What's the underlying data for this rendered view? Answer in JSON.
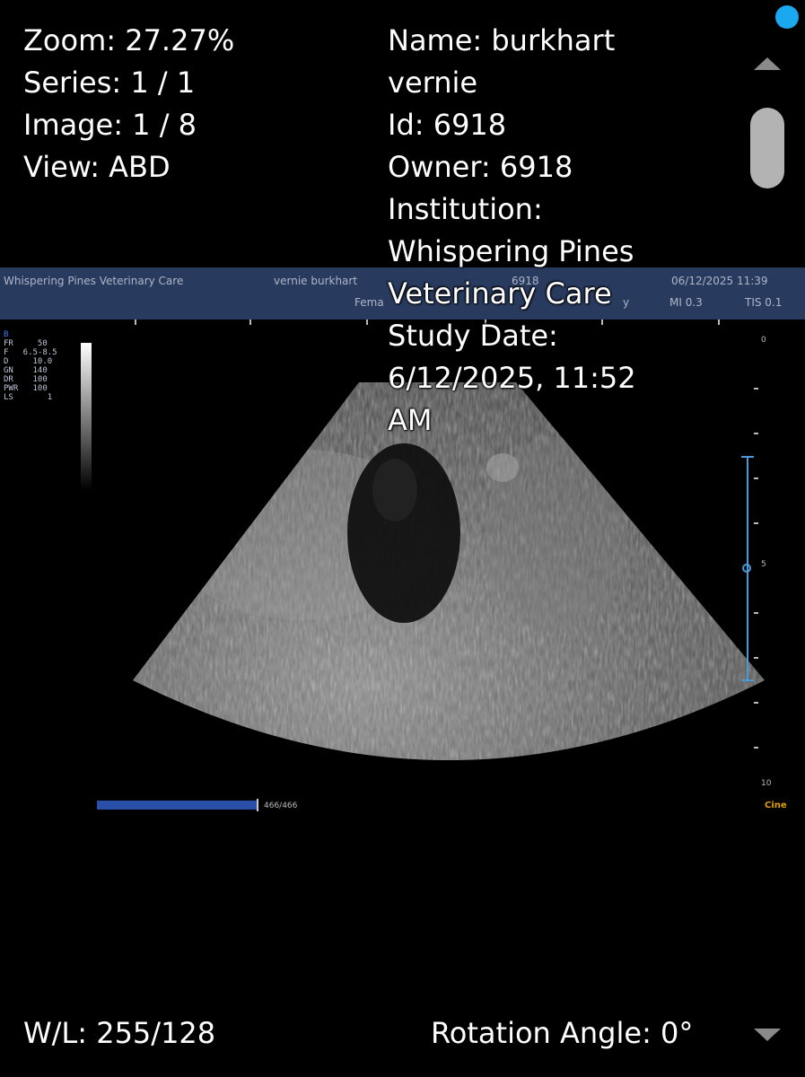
{
  "overlay": {
    "zoom": "Zoom: 27.27%",
    "series": "Series: 1 / 1",
    "image": "Image: 1 / 8",
    "view": "View: ABD",
    "name_line1": "Name: burkhart",
    "name_line2": "vernie",
    "id": "Id: 6918",
    "owner": "Owner: 6918",
    "institution_label": "Institution:",
    "institution_line1": "Whispering Pines",
    "institution_line2": "Veterinary Care",
    "study_date_label": "Study Date:",
    "study_date_line1": "6/12/2025, 11:52",
    "study_date_line2": "AM",
    "wl": "W/L: 255/128",
    "rotation": "Rotation Angle: 0°"
  },
  "ultrasound": {
    "banner_clinic": "Whispering Pines Veterinary Care",
    "banner_patient": "vernie burkhart",
    "banner_sex": "Fema",
    "banner_id": "6918",
    "banner_suffix": "y",
    "banner_datetime": "06/12/2025 11:39",
    "banner_mi": "MI 0.3",
    "banner_tis": "TIS 0.1",
    "mode": "B",
    "params": [
      "FR     50",
      "F   6.5-8.5",
      "D     10.0",
      "GN    140",
      "DR    100",
      "PWR   100",
      "LS       1"
    ],
    "depth_top": "0",
    "depth_mid": "5",
    "depth_bottom": "10",
    "cine_label": "Cine",
    "cine_count": "466/466",
    "cine_progress": 1.0
  },
  "colors": {
    "status_dot": "#1aa8f0",
    "banner": "#283a5e",
    "focus": "#4a9ad8",
    "cine_bar": "#2a4fa8",
    "cine_label": "#e0a000"
  },
  "icons": {
    "status": "status-dot-icon",
    "scroll_up": "chevron-up-icon",
    "scroll_down": "chevron-down-icon"
  }
}
